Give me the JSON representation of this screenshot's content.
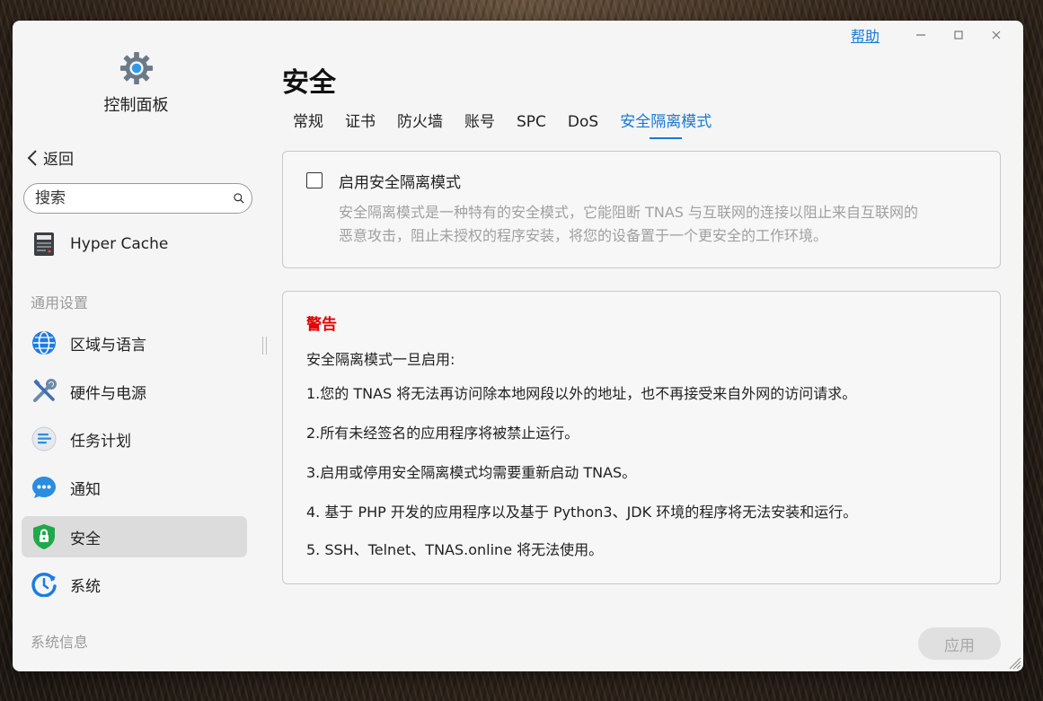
{
  "window": {
    "help_label": "帮助",
    "minimize": "–",
    "maximize": "□",
    "close": "×"
  },
  "sidebar": {
    "app_title": "控制面板",
    "back_label": "返回",
    "search_placeholder": "搜索",
    "top_item": {
      "label": "Hyper Cache",
      "icon": "ssd-icon"
    },
    "section_general": "通用设置",
    "items": [
      {
        "label": "区域与语言",
        "icon": "globe-icon"
      },
      {
        "label": "硬件与电源",
        "icon": "tools-icon"
      },
      {
        "label": "任务计划",
        "icon": "task-list-icon"
      },
      {
        "label": "通知",
        "icon": "chat-bubble-icon"
      },
      {
        "label": "安全",
        "icon": "shield-lock-icon",
        "active": true
      },
      {
        "label": "系统",
        "icon": "system-clock-icon"
      }
    ],
    "section_sysinfo": "系统信息"
  },
  "main": {
    "title": "安全",
    "tabs": [
      "常规",
      "证书",
      "防火墙",
      "账号",
      "SPC",
      "DoS",
      "安全隔离模式"
    ],
    "active_tab": "安全隔离模式",
    "isolation": {
      "checkbox_label": "启用安全隔离模式",
      "checked": false,
      "description_line1": "安全隔离模式是一种特有的安全模式，它能阻断 TNAS 与互联网的连接以阻止来自互联网的",
      "description_line2": "恶意攻击，阻止未授权的程序安装，将您的设备置于一个更安全的工作环境。"
    },
    "warning": {
      "title": "警告",
      "intro": "安全隔离模式一旦启用:",
      "line1": "1.您的 TNAS 将无法再访问除本地网段以外的地址，也不再接受来自外网的访问请求。",
      "line2": "2.所有未经签名的应用程序将被禁止运行。",
      "line3": "3.启用或停用安全隔离模式均需要重新启动 TNAS。",
      "line4": "4. 基于 PHP 开发的应用程序以及基于 Python3、JDK 环境的程序将无法安装和运行。",
      "line5": "5. SSH、Telnet、TNAS.online 将无法使用。"
    },
    "apply_label": "应用"
  },
  "colors": {
    "accent": "#1a78d2",
    "warning": "#e00000",
    "active_nav_bg": "#dcdcdc"
  }
}
